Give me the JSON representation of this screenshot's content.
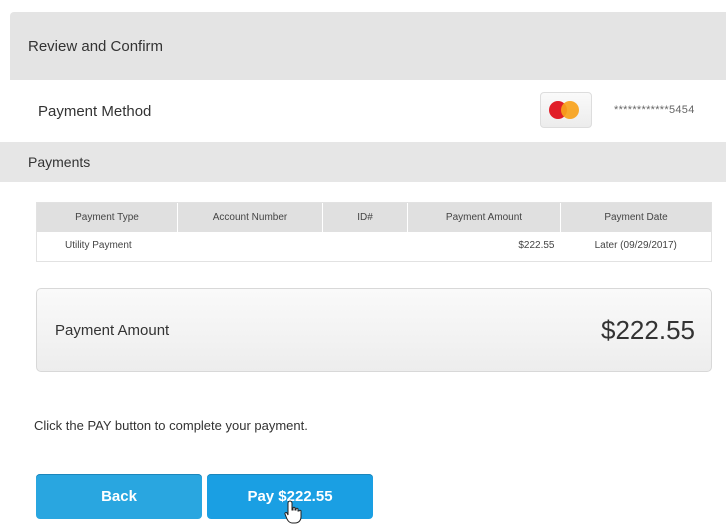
{
  "header": {
    "title": "Review and Confirm"
  },
  "payment_method": {
    "label": "Payment Method",
    "card_icon": "mastercard-icon",
    "masked_number": "************5454"
  },
  "payments": {
    "title": "Payments",
    "columns": [
      "Payment Type",
      "Account Number",
      "ID#",
      "Payment Amount",
      "Payment Date"
    ],
    "rows": [
      {
        "type": "Utility Payment",
        "account": "",
        "id": "",
        "amount": "$222.55",
        "date": "Later (09/29/2017)"
      }
    ]
  },
  "summary": {
    "label": "Payment Amount",
    "value": "$222.55"
  },
  "instructions": "Click the PAY button to complete your payment.",
  "buttons": {
    "back": "Back",
    "pay": "Pay $222.55"
  },
  "colors": {
    "button": "#29a6e0",
    "header_bg": "#e4e4e4"
  }
}
